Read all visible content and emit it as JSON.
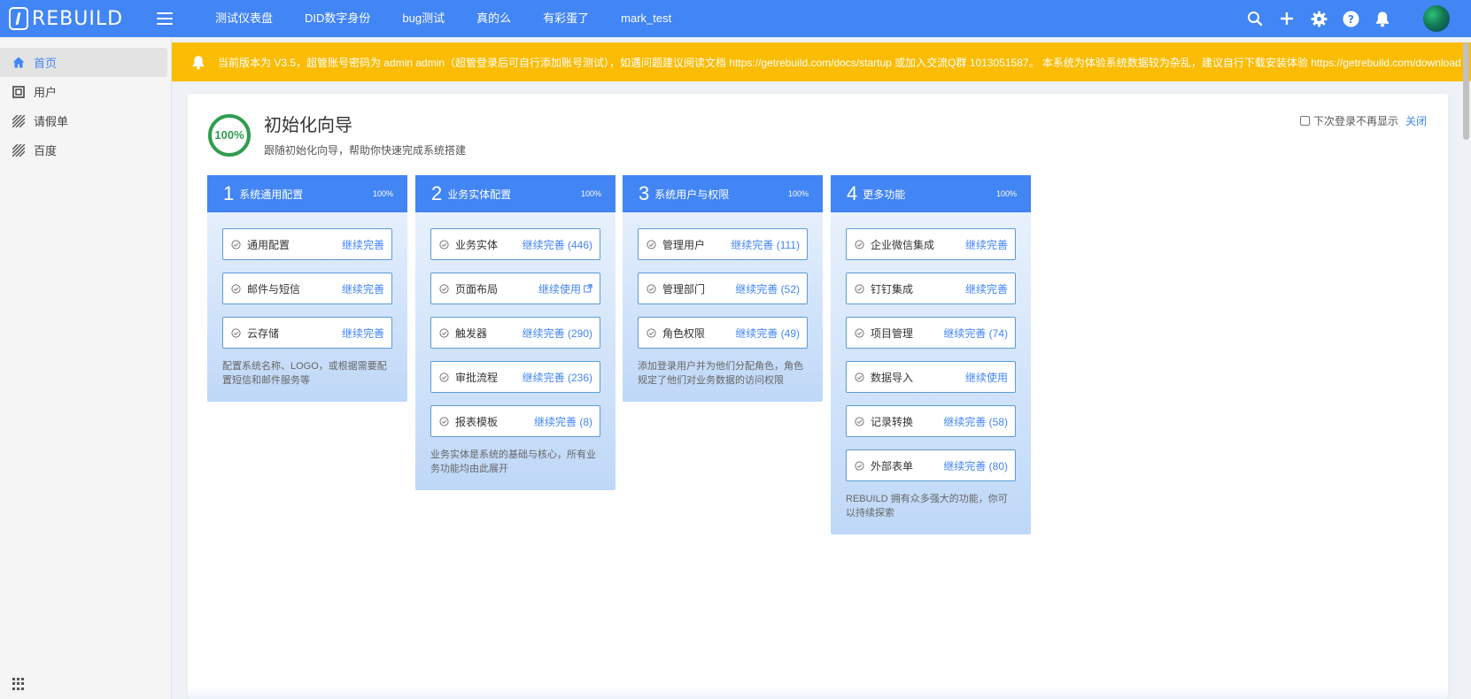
{
  "header": {
    "logo_text": "REBUILD",
    "nav": [
      {
        "label": "测试仪表盘"
      },
      {
        "label": "DID数字身份"
      },
      {
        "label": "bug测试"
      },
      {
        "label": "真的么"
      },
      {
        "label": "有彩蛋了"
      },
      {
        "label": "mark_test"
      }
    ],
    "icons": [
      "search-icon",
      "plus-icon",
      "gear-icon",
      "help-icon",
      "bell-icon"
    ]
  },
  "sidebar": {
    "items": [
      {
        "label": "首页",
        "icon": "home-icon",
        "active": true
      },
      {
        "label": "用户",
        "icon": "user-entity-icon"
      },
      {
        "label": "请假单",
        "icon": "hatched-entity-icon"
      },
      {
        "label": "百度",
        "icon": "hatched-entity-icon"
      }
    ]
  },
  "notice": {
    "text": "当前版本为 V3.5，超管账号密码为 admin admin（超管登录后可自行添加账号测试），如遇问题建议阅读文档 https://getrebuild.com/docs/startup 或加入交流Q群 1013051587。 本系统为体验系统数据较为杂乱，建议自行下载安装体验 https://getrebuild.com/download"
  },
  "guide": {
    "percent": "100%",
    "progress": 1.0,
    "title": "初始化向导",
    "subtitle": "跟随初始化向导，帮助你快速完成系统搭建",
    "dont_show_label": "下次登录不再显示",
    "close_label": "关闭"
  },
  "cards": [
    {
      "num": "1",
      "title": "系统通用配置",
      "percent": "100%",
      "steps": [
        {
          "name": "通用配置",
          "action": "继续完善"
        },
        {
          "name": "邮件与短信",
          "action": "继续完善"
        },
        {
          "name": "云存储",
          "action": "继续完善"
        }
      ],
      "desc": "配置系统名称、LOGO，或根据需要配置短信和邮件服务等"
    },
    {
      "num": "2",
      "title": "业务实体配置",
      "percent": "100%",
      "steps": [
        {
          "name": "业务实体",
          "action": "继续完善 (446)"
        },
        {
          "name": "页面布局",
          "action": "继续使用",
          "external": true
        },
        {
          "name": "触发器",
          "action": "继续完善 (290)"
        },
        {
          "name": "审批流程",
          "action": "继续完善 (236)"
        },
        {
          "name": "报表模板",
          "action": "继续完善 (8)"
        }
      ],
      "desc": "业务实体是系统的基础与核心，所有业务功能均由此展开"
    },
    {
      "num": "3",
      "title": "系统用户与权限",
      "percent": "100%",
      "steps": [
        {
          "name": "管理用户",
          "action": "继续完善 (111)"
        },
        {
          "name": "管理部门",
          "action": "继续完善 (52)"
        },
        {
          "name": "角色权限",
          "action": "继续完善 (49)"
        }
      ],
      "desc": "添加登录用户并为他们分配角色，角色规定了他们对业务数据的访问权限"
    },
    {
      "num": "4",
      "title": "更多功能",
      "percent": "100%",
      "steps": [
        {
          "name": "企业微信集成",
          "action": "继续完善"
        },
        {
          "name": "钉钉集成",
          "action": "继续完善"
        },
        {
          "name": "项目管理",
          "action": "继续完善 (74)"
        },
        {
          "name": "数据导入",
          "action": "继续使用"
        },
        {
          "name": "记录转换",
          "action": "继续完善 (58)"
        },
        {
          "name": "外部表单",
          "action": "继续完善 (80)"
        }
      ],
      "desc": "REBUILD 拥有众多强大的功能，你可以持续探索"
    }
  ],
  "colors": {
    "primary": "#4285f4",
    "notice_bg": "#fbbc05",
    "success": "#2e9e4f"
  }
}
